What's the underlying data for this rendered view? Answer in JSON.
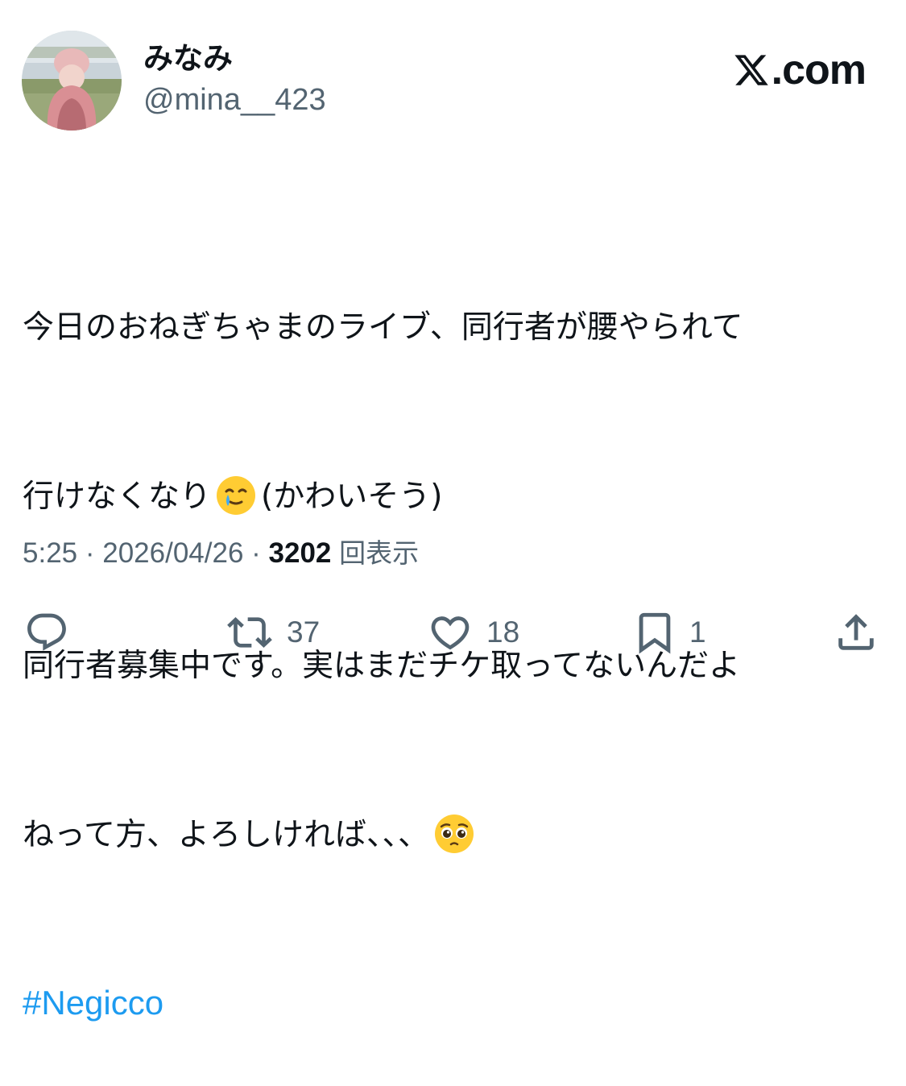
{
  "author": {
    "display_name": "みなみ",
    "handle": "@mina__423"
  },
  "brand": {
    "label": ".com",
    "logo": "x-logo-icon"
  },
  "tweet": {
    "line1": "今日のおねぎちゃまのライブ、同行者が腰やられて",
    "line2_before": "行けなくなり",
    "line2_after": "(かわいそう)",
    "line3": "同行者募集中です。実はまだチケ取ってないんだよ",
    "line4": "ねって方、よろしければ、、、",
    "hashtag": "#Negicco",
    "emojis": [
      "smiling-face-with-tear-emoji",
      "pleading-face-emoji"
    ]
  },
  "meta": {
    "time": "5:25",
    "sep1": " · ",
    "date": "2026/04/26",
    "sep2": " · ",
    "views_count": "3202",
    "views_label": "回表示"
  },
  "actions": {
    "reply": {
      "icon": "reply-icon",
      "count": ""
    },
    "retweet": {
      "icon": "retweet-icon",
      "count": "37"
    },
    "like": {
      "icon": "heart-icon",
      "count": "18"
    },
    "bookmark": {
      "icon": "bookmark-icon",
      "count": "1"
    },
    "share": {
      "icon": "share-icon",
      "count": ""
    }
  },
  "colors": {
    "text": "#0f1419",
    "secondary": "#536471",
    "link": "#1d9bf0",
    "background": "#ffffff"
  }
}
